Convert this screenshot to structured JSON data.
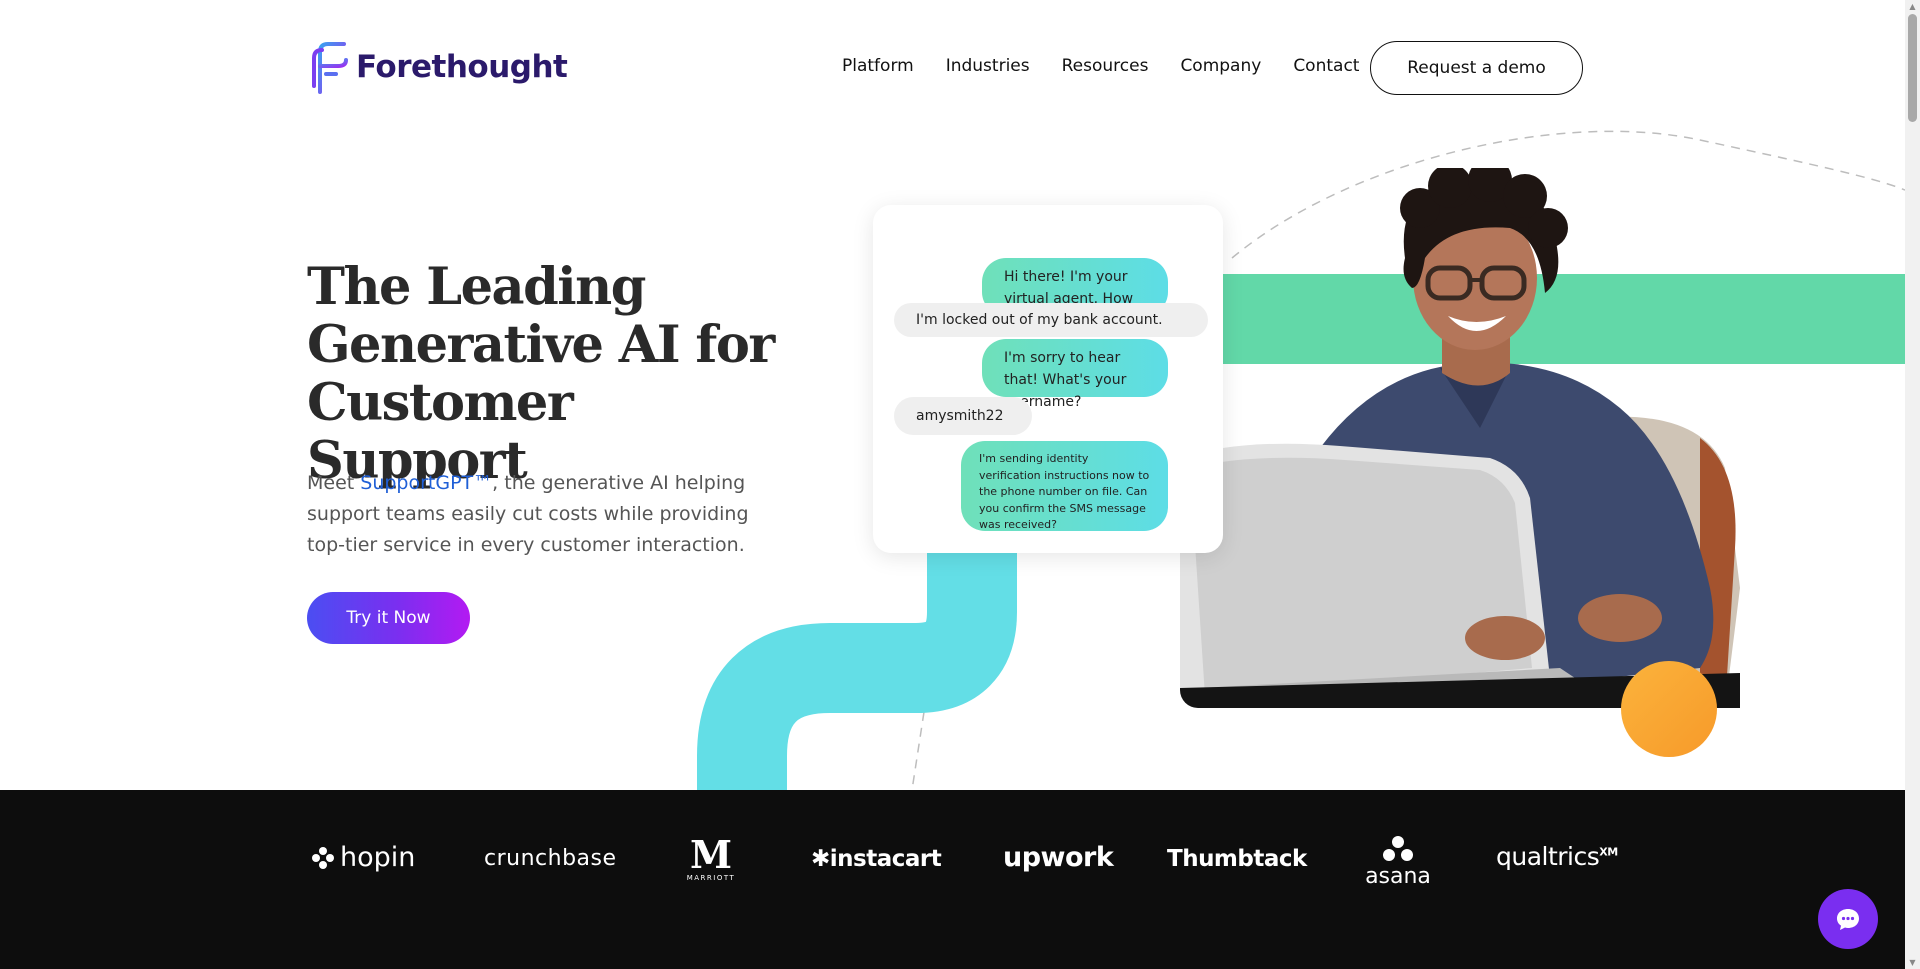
{
  "header": {
    "logo_text": "Forethought",
    "nav": [
      "Platform",
      "Industries",
      "Resources",
      "Company",
      "Contact"
    ],
    "demo_button": "Request a demo"
  },
  "hero": {
    "title_lines": [
      "The Leading",
      "Generative AI for",
      "Customer Support"
    ],
    "desc_before": "Meet ",
    "desc_link": "SupportGPT™",
    "desc_after": ", the generative AI helping support teams easily cut costs while providing top-tier service in every customer interaction.",
    "cta": "Try it Now"
  },
  "chat": {
    "messages": [
      {
        "from": "agent",
        "text": "Hi there! I'm your virtual agent. How can I help?"
      },
      {
        "from": "user",
        "text": "I'm locked out of my bank account."
      },
      {
        "from": "agent",
        "text": "I'm sorry to hear that! What's your username?"
      },
      {
        "from": "user",
        "text": "amysmith22"
      },
      {
        "from": "agent",
        "text": "I'm sending identity verification instructions now to the phone number on file. Can you confirm the SMS message was received?"
      }
    ]
  },
  "logos": {
    "hopin": "hopin",
    "crunchbase": "crunchbase",
    "marriott": "MARRIOTT",
    "instacart": "instacart",
    "upwork": "upwork",
    "thumbtack": "Thumbtack",
    "asana": "asana",
    "qualtrics": "qualtrics",
    "qualtrics_sup": "XM"
  },
  "colors": {
    "brand_purple": "#2b1a6b",
    "accent_teal": "#62d8a8",
    "accent_cyan": "#5ddde6",
    "cta_gradient_start": "#4b4ef2",
    "cta_gradient_end": "#b31af2",
    "orange": "#f7a531",
    "link_blue": "#1f5fd6"
  },
  "icons": {
    "logo": "forethought-f-logo",
    "chat_widget": "chat-bubble-icon"
  }
}
